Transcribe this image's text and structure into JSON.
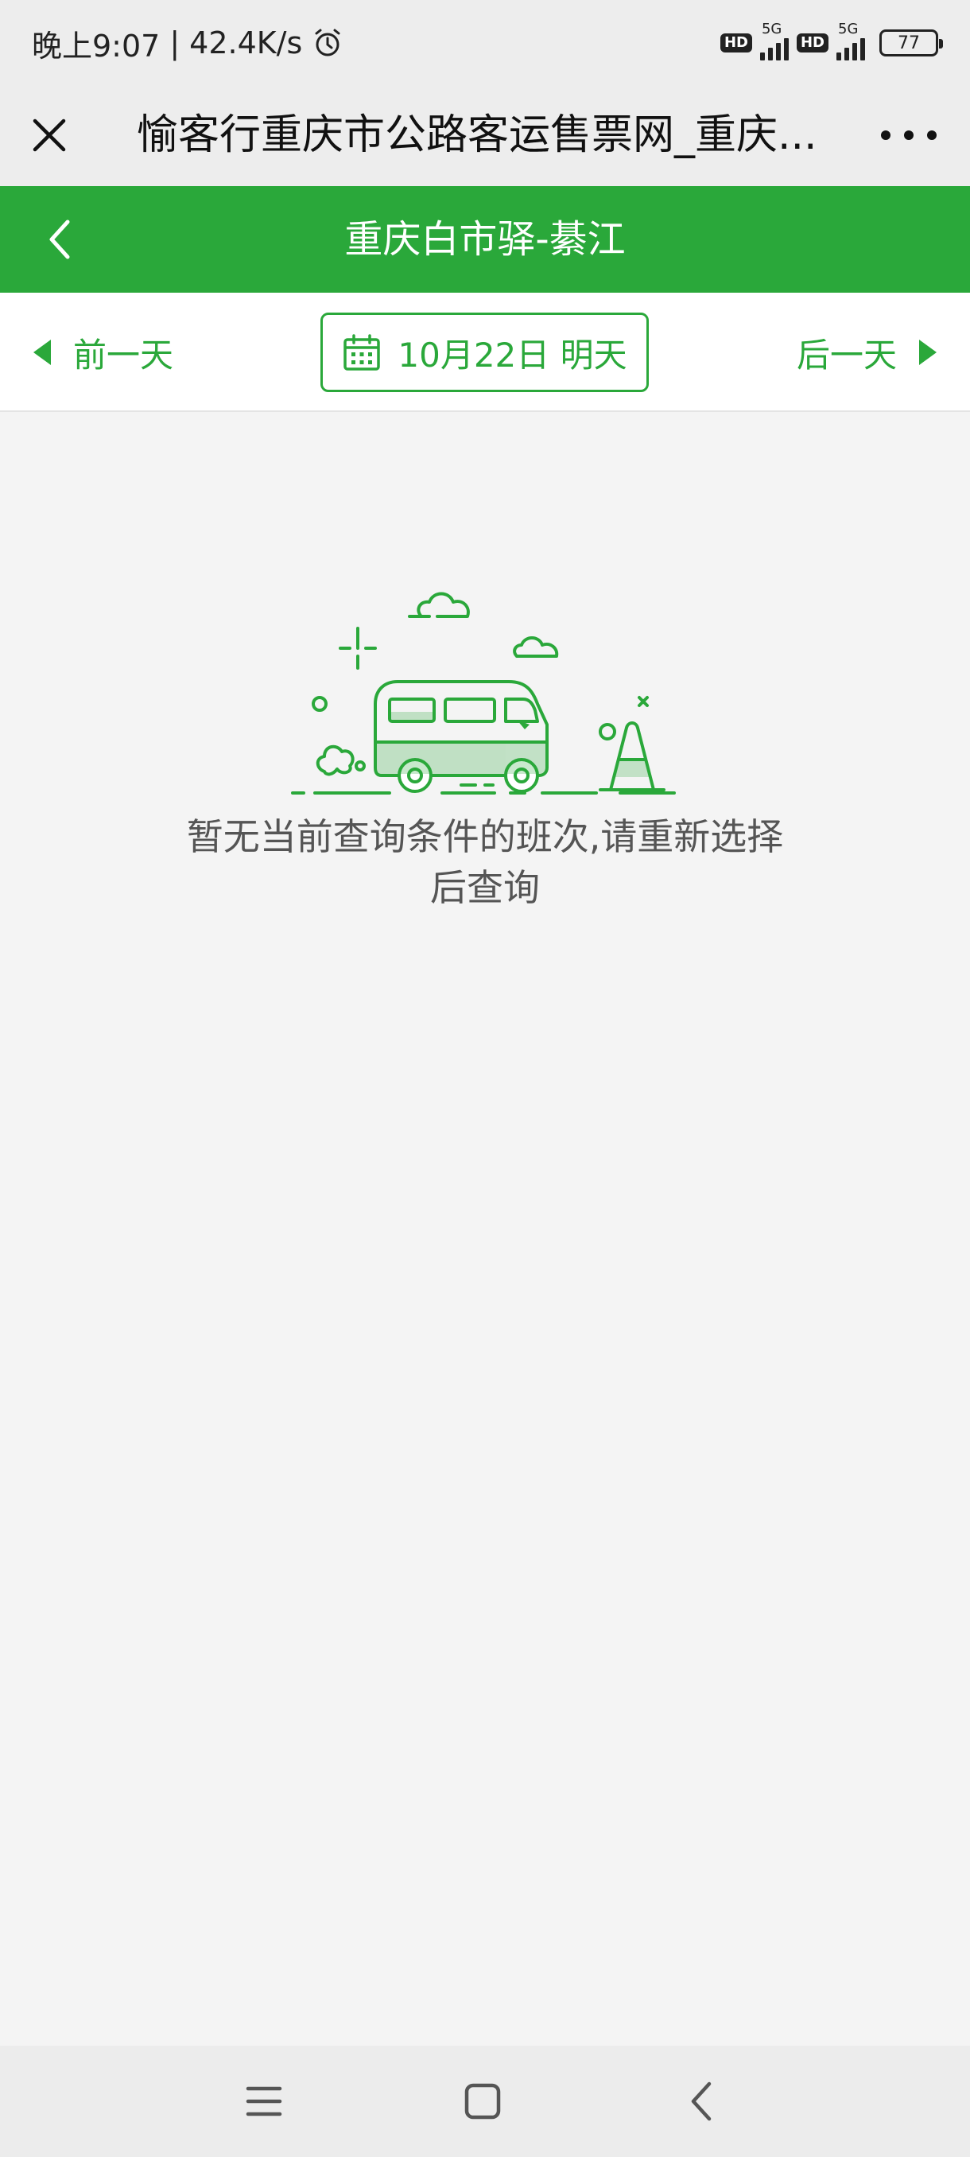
{
  "status_bar": {
    "time": "晚上9:07",
    "separator": "|",
    "speed": "42.4K/s",
    "sim1_hd": "HD",
    "sim1_network": "5G",
    "sim2_hd": "HD",
    "sim2_network": "5G",
    "battery": "77"
  },
  "title_bar": {
    "title": "愉客行重庆市公路客运售票网_重庆..."
  },
  "header": {
    "route": "重庆白市驿-綦江"
  },
  "date_bar": {
    "prev_label": "前一天",
    "date_label": "10月22日 明天",
    "next_label": "后一天"
  },
  "empty_state": {
    "message": "暂无当前查询条件的班次,请重新选择后查询"
  },
  "colors": {
    "brand_green": "#2aa83a",
    "background": "#f4f4f4"
  },
  "icons": {
    "close": "close-icon",
    "more": "more-icon",
    "back": "chevron-left-icon",
    "calendar": "calendar-icon",
    "alarm": "alarm-icon",
    "menu": "menu-icon",
    "home": "home-icon",
    "nav_back": "back-icon"
  }
}
